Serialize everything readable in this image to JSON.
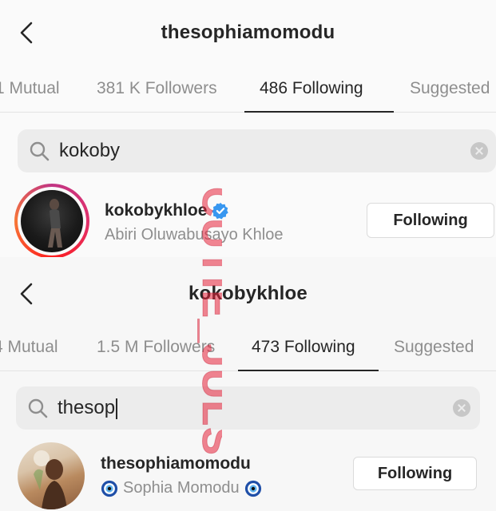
{
  "panel1": {
    "header": {
      "title": "thesophiamomodu"
    },
    "tabs": [
      {
        "label": "1 Mutual"
      },
      {
        "label": "381 K Followers"
      },
      {
        "label": "486 Following"
      },
      {
        "label": "Suggested"
      }
    ],
    "search": {
      "query": "kokoby"
    },
    "result": {
      "username": "kokobykhloe",
      "full_name": "Abiri Oluwabusayo Khloe",
      "button": "Following",
      "verified": true
    }
  },
  "panel2": {
    "header": {
      "title": "kokobykhloe"
    },
    "tabs": [
      {
        "label": "4 Mutual"
      },
      {
        "label": "1.5 M Followers"
      },
      {
        "label": "473 Following"
      },
      {
        "label": "Suggested"
      }
    ],
    "search": {
      "query": "thesop"
    },
    "result": {
      "username": "thesophiamomodu",
      "full_name": "Sophia Momodu",
      "button": "Following"
    }
  },
  "watermark": {
    "text": "CUTIE_JULS"
  },
  "colors": {
    "text_primary": "#262626",
    "text_secondary": "#8e8e8e",
    "verified_blue": "#3897f0",
    "watermark_red": "#e8223a",
    "story_ring": "#c13584"
  },
  "icons": [
    "back-chevron-icon",
    "search-icon",
    "clear-icon",
    "verified-badge-icon",
    "nazar-eye-icon"
  ]
}
